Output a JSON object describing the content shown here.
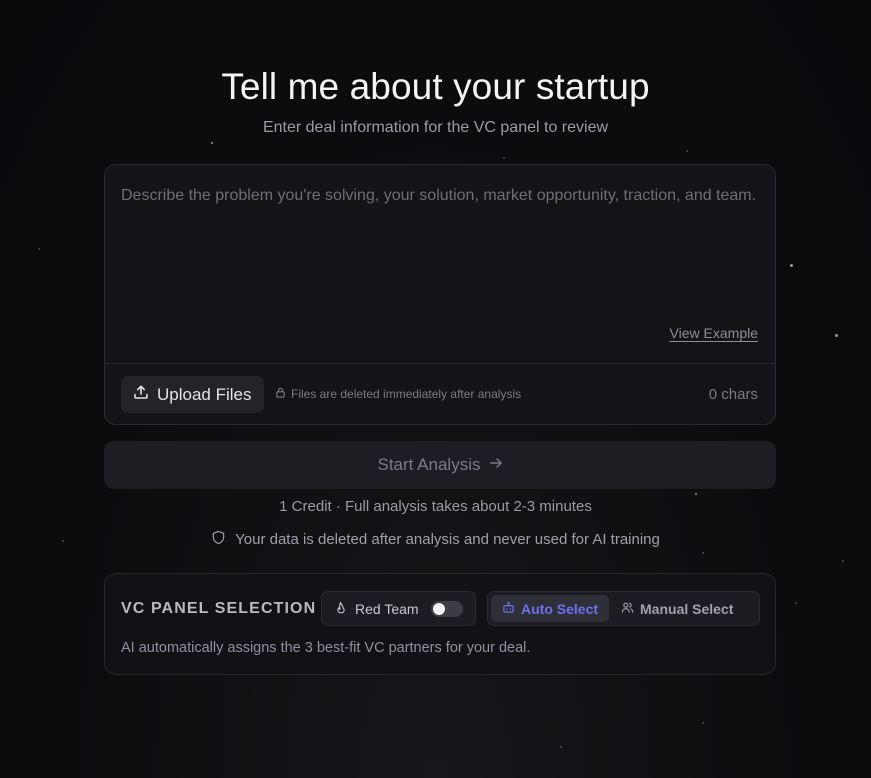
{
  "hero": {
    "title": "Tell me about your startup",
    "subtitle": "Enter deal information for the VC panel to review"
  },
  "input_card": {
    "placeholder": "Describe the problem you're solving, your solution, market opportunity, traction, and team.",
    "value": "",
    "view_example_label": "View Example",
    "upload_label": "Upload Files",
    "files_note": "Files are deleted immediately after analysis",
    "char_count": "0 chars"
  },
  "start_button": {
    "label": "Start Analysis",
    "icon": "arrow-right-icon",
    "disabled": true
  },
  "info": {
    "credit_line": "1 Credit · Full analysis takes about 2-3 minutes",
    "privacy_line": "Your data is deleted after analysis and never used for AI training"
  },
  "vc_panel": {
    "title": "VC PANEL SELECTION",
    "red_team_label": "Red Team",
    "red_team_enabled": false,
    "modes": [
      {
        "label": "Auto Select",
        "icon": "bot-icon",
        "active": true
      },
      {
        "label": "Manual Select",
        "icon": "users-icon",
        "active": false
      }
    ],
    "description": "AI automatically assigns the 3 best-fit VC partners for your deal."
  },
  "colors": {
    "background": "#0c0c0f",
    "card": "#131318",
    "accent": "#6b72ee",
    "muted_text": "#9b9ba6"
  }
}
